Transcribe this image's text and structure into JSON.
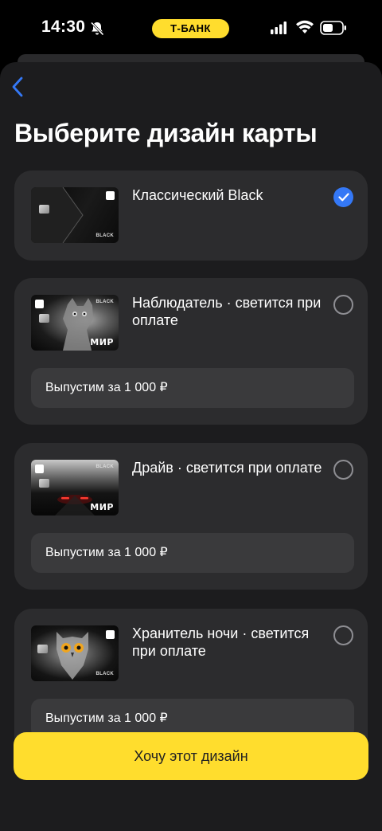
{
  "status_bar": {
    "time": "14:30",
    "carrier_badge": "Т-БАНК",
    "icons": [
      "bell-slash-icon",
      "signal-icon",
      "wifi-icon",
      "battery-icon"
    ]
  },
  "header": {
    "back_icon": "chevron-left-icon",
    "title": "Выберите дизайн карты"
  },
  "options": [
    {
      "name": "Классический Black",
      "selected": true,
      "price": ""
    },
    {
      "name": "Наблюдатель · светится при оплате",
      "selected": false,
      "price": "Выпустим за 1 000 ₽"
    },
    {
      "name": "Драйв · светится при оплате",
      "selected": false,
      "price": "Выпустим за 1 000 ₽"
    },
    {
      "name": "Хранитель ночи · светится при оплате",
      "selected": false,
      "price": "Выпустим за 1 000 ₽"
    }
  ],
  "card_labels": {
    "brand": "BLACK",
    "payment_system": "МИР"
  },
  "cta": {
    "label": "Хочу этот дизайн"
  },
  "colors": {
    "accent_yellow": "#FFDD2D",
    "selected_blue": "#3478F6",
    "card_bg": "#2c2c2e",
    "sheet_bg": "#1c1c1e"
  }
}
